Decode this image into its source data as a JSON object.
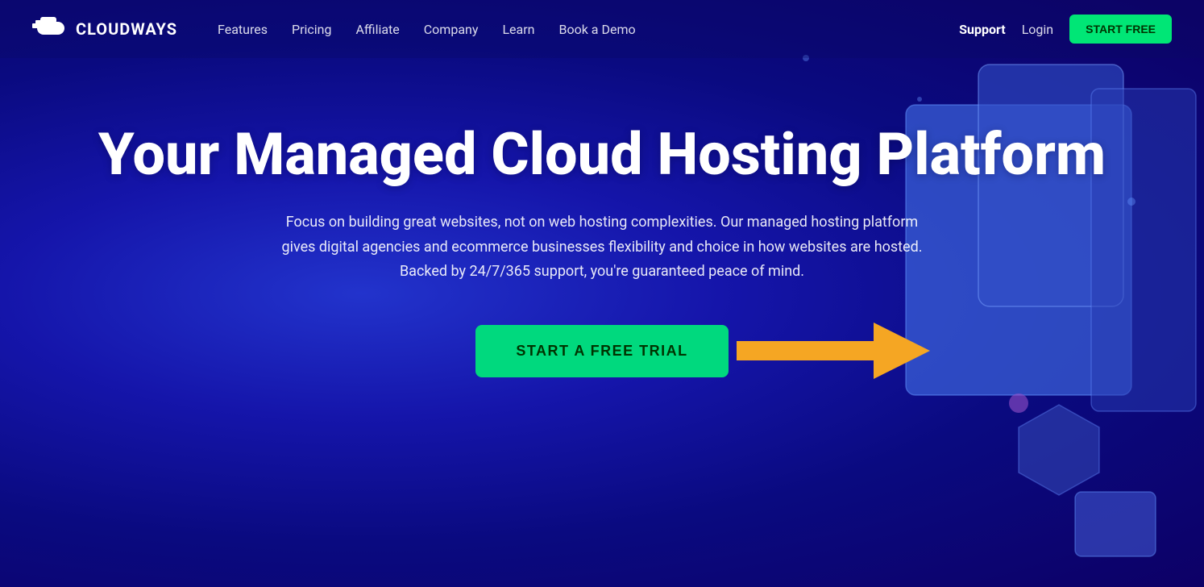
{
  "brand": {
    "name": "CLOUDWAYS"
  },
  "navbar": {
    "links": [
      {
        "label": "Features",
        "id": "features"
      },
      {
        "label": "Pricing",
        "id": "pricing"
      },
      {
        "label": "Affiliate",
        "id": "affiliate"
      },
      {
        "label": "Company",
        "id": "company"
      },
      {
        "label": "Learn",
        "id": "learn"
      },
      {
        "label": "Book a Demo",
        "id": "book-demo"
      }
    ],
    "support_label": "Support",
    "login_label": "Login",
    "cta_label": "START FREE"
  },
  "hero": {
    "title": "Your Managed Cloud Hosting Platform",
    "subtitle": "Focus on building great websites, not on web hosting complexities. Our managed hosting platform gives digital agencies and ecommerce businesses flexibility and choice in how websites are hosted. Backed by 24/7/365 support, you're guaranteed peace of mind.",
    "cta_label": "START A FREE TRIAL"
  }
}
